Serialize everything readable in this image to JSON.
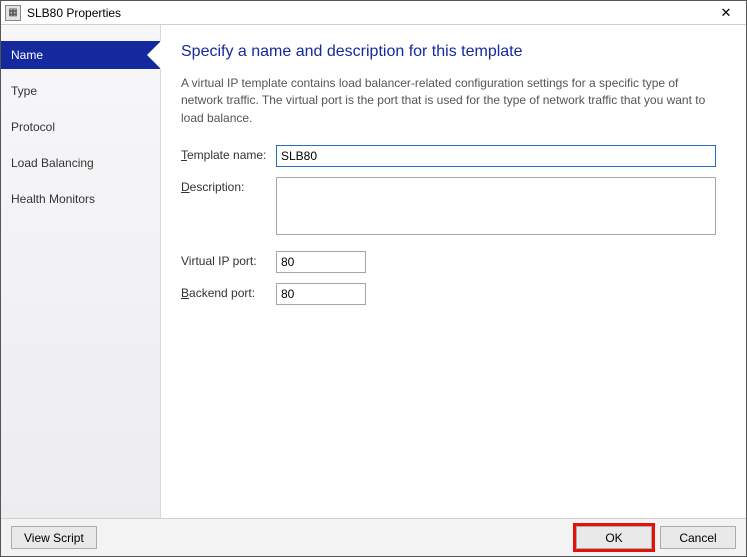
{
  "window": {
    "title": "SLB80 Properties",
    "close_label": "✕"
  },
  "sidebar": {
    "items": [
      {
        "label": "Name",
        "active": true
      },
      {
        "label": "Type",
        "active": false
      },
      {
        "label": "Protocol",
        "active": false
      },
      {
        "label": "Load Balancing",
        "active": false
      },
      {
        "label": "Health Monitors",
        "active": false
      }
    ]
  },
  "main": {
    "heading": "Specify a name and description for this template",
    "intro": "A virtual IP template contains load balancer-related configuration settings for a specific type of network traffic. The virtual port is the port that is used for the type of network traffic that you want to load balance.",
    "fields": {
      "template_name": {
        "label": "Template name:",
        "value": "SLB80"
      },
      "description": {
        "label": "Description:",
        "value": ""
      },
      "vip_port": {
        "label": "Virtual IP port:",
        "value": "80"
      },
      "backend_port": {
        "label": "Backend port:",
        "value": "80"
      }
    }
  },
  "buttons": {
    "view_script": "View Script",
    "ok": "OK",
    "cancel": "Cancel"
  }
}
